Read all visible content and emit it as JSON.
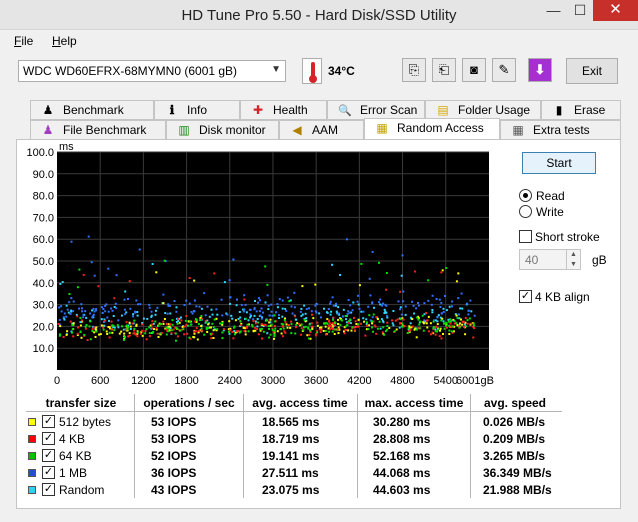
{
  "window": {
    "title": "HD Tune Pro 5.50 - Hard Disk/SSD Utility",
    "minimize": "—",
    "maximize": "☐",
    "close": "✕"
  },
  "menu": [
    {
      "label": "File",
      "u": "F",
      "rest": "ile"
    },
    {
      "label": "Help",
      "u": "H",
      "rest": "elp"
    }
  ],
  "toolbar": {
    "drive": "WDC WD60EFRX-68MYMN0 (6001 gB)",
    "temperature": "34°C",
    "exit": "Exit"
  },
  "tabs_row1": [
    {
      "label": "Benchmark",
      "icon": "benchmark-icon",
      "glyph": "♟"
    },
    {
      "label": "Info",
      "icon": "info-icon",
      "glyph": "ℹ"
    },
    {
      "label": "Health",
      "icon": "health-icon",
      "glyph": "✚"
    },
    {
      "label": "Error Scan",
      "icon": "magnifier-icon",
      "glyph": "🔍"
    },
    {
      "label": "Folder Usage",
      "icon": "folder-icon",
      "glyph": "▤"
    },
    {
      "label": "Erase",
      "icon": "trash-icon",
      "glyph": "▮"
    }
  ],
  "tabs_row2": [
    {
      "label": "File Benchmark",
      "icon": "file-benchmark-icon",
      "glyph": "♟"
    },
    {
      "label": "Disk monitor",
      "icon": "disk-monitor-icon",
      "glyph": "▥"
    },
    {
      "label": "AAM",
      "icon": "speaker-icon",
      "glyph": "◀"
    },
    {
      "label": "Random Access",
      "icon": "random-access-icon",
      "glyph": "▦",
      "active": true
    },
    {
      "label": "Extra tests",
      "icon": "extra-tests-icon",
      "glyph": "▦"
    }
  ],
  "controls": {
    "start": "Start",
    "read": "Read",
    "write": "Write",
    "short_stroke": "Short stroke",
    "stroke_value": "40",
    "stroke_unit": "gB",
    "align": "4 KB align",
    "read_selected": true,
    "short_stroke_checked": false,
    "align_checked": true
  },
  "chart_data": {
    "type": "scatter",
    "ylabel": "ms",
    "xlabel": "gB",
    "ylim": [
      0,
      100
    ],
    "xlim": [
      0,
      6001
    ],
    "yticks": [
      "100.0",
      "90.0",
      "80.0",
      "70.0",
      "60.0",
      "50.0",
      "40.0",
      "30.0",
      "20.0",
      "10.0"
    ],
    "xticks": [
      "0",
      "600",
      "1200",
      "1800",
      "2400",
      "3000",
      "3600",
      "4200",
      "4800",
      "5400",
      "6001gB"
    ],
    "grid": true,
    "series": [
      {
        "name": "512 bytes",
        "color": "#ffff00",
        "center": 18.5,
        "spread": 7
      },
      {
        "name": "4 KB",
        "color": "#ff2020",
        "center": 18.7,
        "spread": 7
      },
      {
        "name": "64 KB",
        "color": "#00e000",
        "center": 19.1,
        "spread": 7
      },
      {
        "name": "1 MB",
        "color": "#3070ff",
        "center": 27.5,
        "spread": 9
      },
      {
        "name": "Random",
        "color": "#30d8ff",
        "center": 23.0,
        "spread": 9
      }
    ]
  },
  "table": {
    "headers": [
      "transfer size",
      "operations / sec",
      "avg. access time",
      "max. access time",
      "avg. speed"
    ],
    "rows": [
      {
        "size": "512 bytes",
        "color": "#ffff00",
        "ops": "53 IOPS",
        "avg": "18.565 ms",
        "max": "30.280 ms",
        "speed": "0.026 MB/s"
      },
      {
        "size": "4 KB",
        "color": "#ff0000",
        "ops": "53 IOPS",
        "avg": "18.719 ms",
        "max": "28.808 ms",
        "speed": "0.209 MB/s"
      },
      {
        "size": "64 KB",
        "color": "#00c000",
        "ops": "52 IOPS",
        "avg": "19.141 ms",
        "max": "52.168 ms",
        "speed": "3.265 MB/s"
      },
      {
        "size": "1 MB",
        "color": "#2050d0",
        "ops": "36 IOPS",
        "avg": "27.511 ms",
        "max": "44.068 ms",
        "speed": "36.349 MB/s"
      },
      {
        "size": "Random",
        "color": "#30d0f0",
        "ops": "43 IOPS",
        "avg": "23.075 ms",
        "max": "44.603 ms",
        "speed": "21.988 MB/s"
      }
    ]
  }
}
